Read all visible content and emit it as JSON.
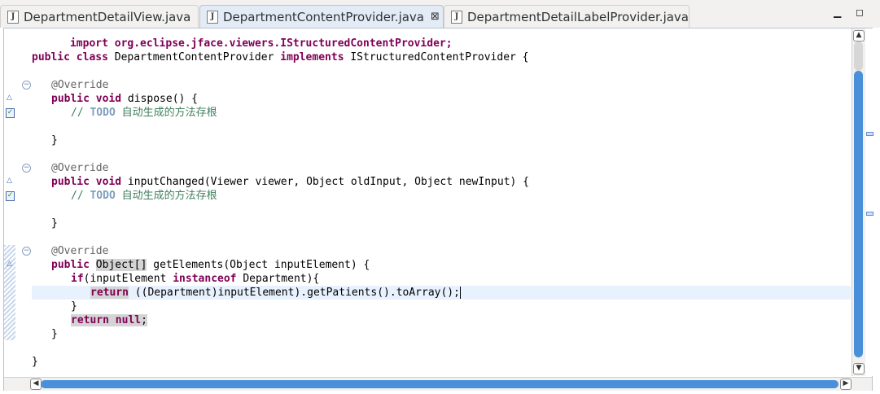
{
  "tabs": [
    {
      "label": "DepartmentDetailView.java",
      "active": false
    },
    {
      "label": "DepartmentContentProvider.java",
      "active": true,
      "close": "⊠"
    },
    {
      "label": "DepartmentDetailLabelProvider.java",
      "active": false
    }
  ],
  "window": {
    "minimize_icon": "minimize-icon",
    "maximize_icon": "maximize-icon"
  },
  "code": {
    "l0": "import org.eclipse.jface.viewers.IStructuredContentProvider;",
    "l2a": "public class",
    "l2b": " DepartmentContentProvider ",
    "l2c": "implements",
    "l2d": " IStructuredContentProvider {",
    "ann": "@Override",
    "pv": "public void",
    "dispose": " dispose() {",
    "todo_prefix": "// ",
    "todo_kw": "TODO",
    "todo_text": " 自动生成的方法存根",
    "brace_close": "}",
    "inputChanged": " inputChanged(Viewer viewer, Object oldInput, Object newInput) {",
    "pub": "public",
    "objarr": "Object[]",
    "getElements": " getElements(Object inputElement) {",
    "if": "if",
    "if_rest_a": "(inputElement ",
    "instanceof": "instanceof",
    "if_rest_b": " Department){",
    "return": "return",
    "return_rest": " ((Department)inputElement).getPatients().toArray();",
    "return2": "return",
    "null": "null",
    "semi": ";"
  },
  "colors": {
    "keyword": "#7f0055",
    "annotation": "#646464",
    "comment": "#3f7f5f",
    "todo": "#7f9fbf",
    "accent": "#4a90d9"
  }
}
